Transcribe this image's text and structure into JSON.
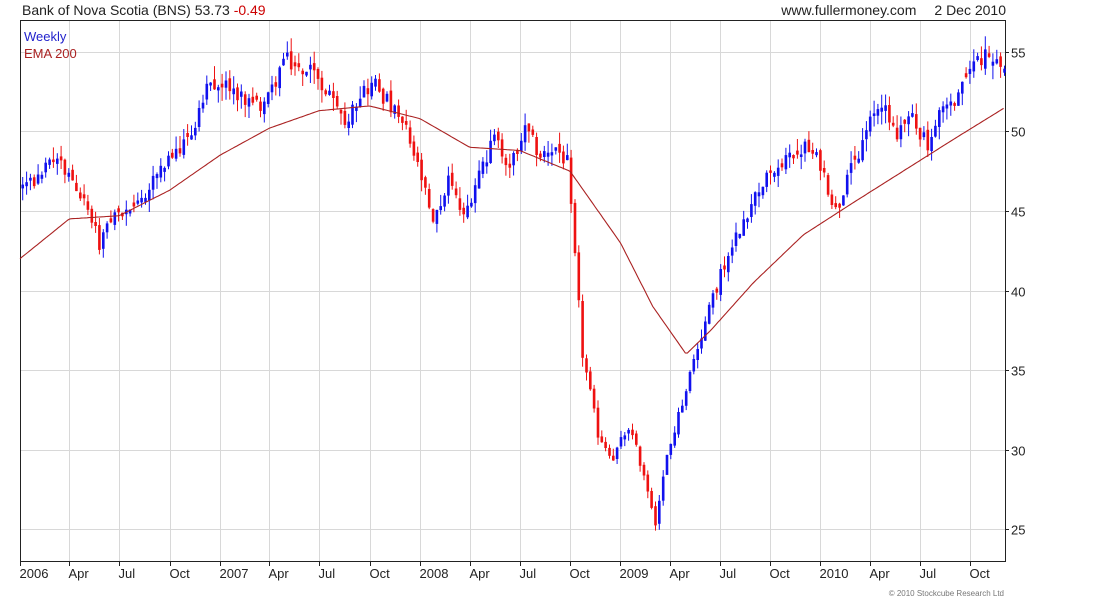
{
  "header": {
    "symbol_label": "Bank of Nova Scotia (BNS)",
    "last_price": "53.73",
    "change": "-0.49",
    "website": "www.fullermoney.com",
    "date": "2 Dec 2010"
  },
  "footer": {
    "copyright": "© 2010 Stockcube Research Ltd"
  },
  "colors": {
    "up": "#1111ee",
    "down": "#ee1111",
    "ema": "#aa2222",
    "grid": "#d8d8d8"
  },
  "chart_data": {
    "type": "candlestick",
    "period": "Weekly",
    "series": [
      {
        "name": "Weekly"
      },
      {
        "name": "EMA 200"
      }
    ],
    "legend_position": "top-left",
    "y_axis_side": "right",
    "ylim": [
      23,
      57
    ],
    "yticks": [
      "25",
      "30",
      "35",
      "40",
      "45",
      "50",
      "55"
    ],
    "grid": true,
    "x_range": [
      "2006-01-01",
      "2010-12-04"
    ],
    "xticks": [
      {
        "label": "2006",
        "date": "2006-01-01"
      },
      {
        "label": "Apr",
        "date": "2006-04-01"
      },
      {
        "label": "Jul",
        "date": "2006-07-01"
      },
      {
        "label": "Oct",
        "date": "2006-10-01"
      },
      {
        "label": "2007",
        "date": "2007-01-01"
      },
      {
        "label": "Apr",
        "date": "2007-04-01"
      },
      {
        "label": "Jul",
        "date": "2007-07-01"
      },
      {
        "label": "Oct",
        "date": "2007-10-01"
      },
      {
        "label": "2008",
        "date": "2008-01-01"
      },
      {
        "label": "Apr",
        "date": "2008-04-01"
      },
      {
        "label": "Jul",
        "date": "2008-07-01"
      },
      {
        "label": "Oct",
        "date": "2008-10-01"
      },
      {
        "label": "2009",
        "date": "2009-01-01"
      },
      {
        "label": "Apr",
        "date": "2009-04-01"
      },
      {
        "label": "Jul",
        "date": "2009-07-01"
      },
      {
        "label": "Oct",
        "date": "2009-10-01"
      },
      {
        "label": "2010",
        "date": "2010-01-01"
      },
      {
        "label": "Apr",
        "date": "2010-04-01"
      },
      {
        "label": "Jul",
        "date": "2010-07-01"
      },
      {
        "label": "Oct",
        "date": "2010-10-01"
      }
    ],
    "close_anchors": [
      [
        "2006-01-06",
        46.5
      ],
      [
        "2006-02-03",
        47.0
      ],
      [
        "2006-03-03",
        48.2
      ],
      [
        "2006-03-31",
        47.5
      ],
      [
        "2006-04-28",
        45.5
      ],
      [
        "2006-05-26",
        43.0
      ],
      [
        "2006-06-23",
        44.5
      ],
      [
        "2006-07-21",
        45.0
      ],
      [
        "2006-08-18",
        46.0
      ],
      [
        "2006-09-15",
        48.0
      ],
      [
        "2006-10-13",
        48.5
      ],
      [
        "2006-11-10",
        50.0
      ],
      [
        "2006-12-08",
        52.5
      ],
      [
        "2007-01-05",
        53.0
      ],
      [
        "2007-02-02",
        52.5
      ],
      [
        "2007-03-02",
        51.5
      ],
      [
        "2007-03-30",
        52.0
      ],
      [
        "2007-04-27",
        54.5
      ],
      [
        "2007-05-25",
        54.0
      ],
      [
        "2007-06-22",
        53.5
      ],
      [
        "2007-07-20",
        52.0
      ],
      [
        "2007-08-17",
        50.5
      ],
      [
        "2007-09-14",
        52.5
      ],
      [
        "2007-10-12",
        53.0
      ],
      [
        "2007-11-09",
        51.5
      ],
      [
        "2007-12-07",
        50.0
      ],
      [
        "2008-01-04",
        47.0
      ],
      [
        "2008-01-25",
        44.0
      ],
      [
        "2008-02-22",
        47.0
      ],
      [
        "2008-03-21",
        44.5
      ],
      [
        "2008-04-18",
        47.5
      ],
      [
        "2008-05-16",
        49.5
      ],
      [
        "2008-06-13",
        48.0
      ],
      [
        "2008-07-11",
        50.0
      ],
      [
        "2008-08-08",
        48.5
      ],
      [
        "2008-09-05",
        49.0
      ],
      [
        "2008-09-26",
        48.0
      ],
      [
        "2008-10-10",
        42.0
      ],
      [
        "2008-10-24",
        36.0
      ],
      [
        "2008-11-21",
        31.0
      ],
      [
        "2008-12-19",
        29.5
      ],
      [
        "2009-01-16",
        31.5
      ],
      [
        "2009-02-13",
        28.5
      ],
      [
        "2009-03-06",
        25.5
      ],
      [
        "2009-03-27",
        29.5
      ],
      [
        "2009-04-24",
        33.0
      ],
      [
        "2009-05-22",
        36.5
      ],
      [
        "2009-06-19",
        39.5
      ],
      [
        "2009-07-17",
        42.5
      ],
      [
        "2009-08-14",
        44.5
      ],
      [
        "2009-09-11",
        46.5
      ],
      [
        "2009-10-09",
        47.5
      ],
      [
        "2009-11-06",
        48.5
      ],
      [
        "2009-12-04",
        49.0
      ],
      [
        "2010-01-01",
        48.0
      ],
      [
        "2010-01-29",
        45.0
      ],
      [
        "2010-02-26",
        47.5
      ],
      [
        "2010-03-26",
        50.0
      ],
      [
        "2010-04-23",
        52.0
      ],
      [
        "2010-05-21",
        50.0
      ],
      [
        "2010-06-18",
        51.0
      ],
      [
        "2010-07-16",
        49.0
      ],
      [
        "2010-08-13",
        51.5
      ],
      [
        "2010-09-10",
        52.0
      ],
      [
        "2010-10-08",
        54.5
      ],
      [
        "2010-11-05",
        54.8
      ],
      [
        "2010-12-03",
        53.73
      ]
    ],
    "ema_anchors": [
      [
        "2006-01-01",
        42.0
      ],
      [
        "2006-04-01",
        44.5
      ],
      [
        "2006-07-01",
        44.7
      ],
      [
        "2006-10-01",
        46.3
      ],
      [
        "2007-01-01",
        48.5
      ],
      [
        "2007-04-01",
        50.2
      ],
      [
        "2007-07-01",
        51.3
      ],
      [
        "2007-10-01",
        51.6
      ],
      [
        "2008-01-01",
        50.8
      ],
      [
        "2008-04-01",
        49.0
      ],
      [
        "2008-07-01",
        48.8
      ],
      [
        "2008-10-01",
        47.5
      ],
      [
        "2009-01-01",
        43.0
      ],
      [
        "2009-03-01",
        39.0
      ],
      [
        "2009-05-01",
        36.0
      ],
      [
        "2009-06-15",
        37.5
      ],
      [
        "2009-09-01",
        40.5
      ],
      [
        "2009-12-01",
        43.5
      ],
      [
        "2010-03-01",
        45.5
      ],
      [
        "2010-06-01",
        47.5
      ],
      [
        "2010-09-01",
        49.5
      ],
      [
        "2010-12-04",
        51.5
      ]
    ]
  }
}
